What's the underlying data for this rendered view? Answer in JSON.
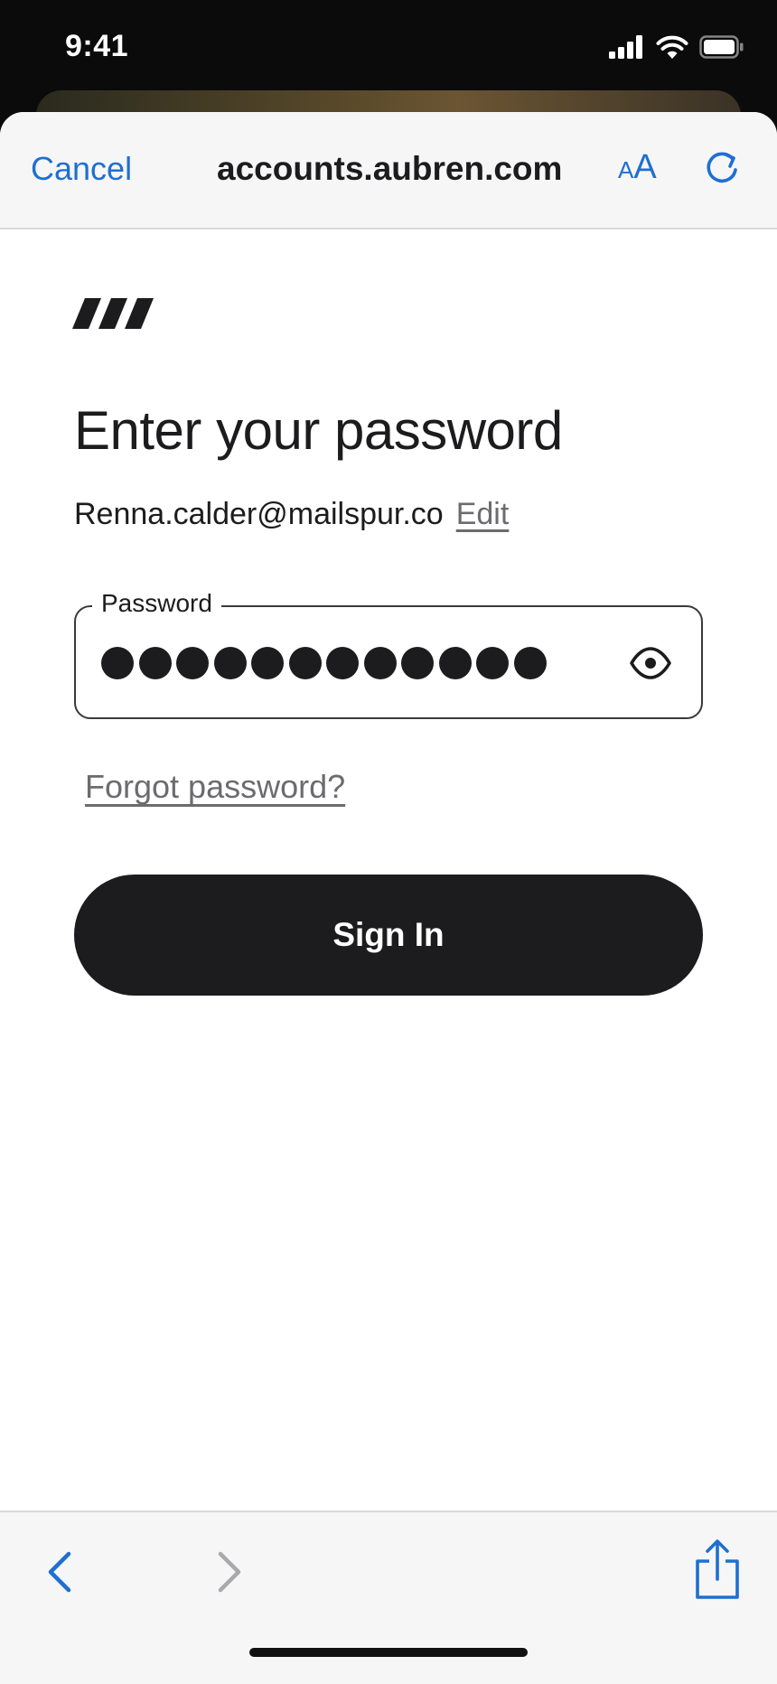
{
  "status_bar": {
    "time": "9:41",
    "icons": [
      "cellular-signal-icon",
      "wifi-icon",
      "battery-icon"
    ],
    "text_color": "#ffffff"
  },
  "nav": {
    "cancel_label": "Cancel",
    "url": "accounts.aubren.com",
    "text_size_small": "A",
    "text_size_big": "A",
    "reload_icon": "reload-icon",
    "accent_color": "#1f6fd0"
  },
  "login": {
    "heading": "Enter your password",
    "email": "Renna.calder@mailspur.co",
    "edit_label": "Edit",
    "password_label": "Password",
    "password_masked_length": 12,
    "show_password_icon": "eye-icon",
    "forgot_label": "Forgot password?",
    "signin_label": "Sign In",
    "button_color": "#1c1c1e"
  },
  "toolbar": {
    "back_icon": "chevron-left-icon",
    "forward_icon": "chevron-right-icon",
    "share_icon": "share-icon"
  }
}
